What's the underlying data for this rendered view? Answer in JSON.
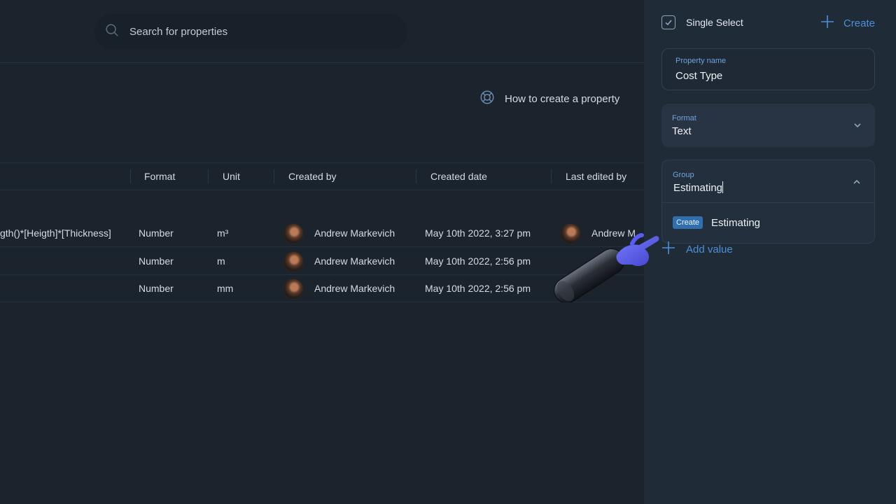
{
  "search": {
    "placeholder": "Search for properties"
  },
  "help": {
    "label": "How to create a property"
  },
  "table": {
    "columns": [
      "Format",
      "Unit",
      "Created by",
      "Created date",
      "Last edited by"
    ],
    "rows": [
      {
        "formula": "gth()*[Heigth]*[Thickness]",
        "format": "Number",
        "unit": "m³",
        "created_by": "Andrew Markevich",
        "created_date": "May 10th 2022, 3:27 pm",
        "last_edited_by": "Andrew M"
      },
      {
        "formula": "",
        "format": "Number",
        "unit": "m",
        "created_by": "Andrew Markevich",
        "created_date": "May 10th 2022, 2:56 pm",
        "last_edited_by": ""
      },
      {
        "formula": "",
        "format": "Number",
        "unit": "mm",
        "created_by": "Andrew Markevich",
        "created_date": "May 10th 2022, 2:56 pm",
        "last_edited_by": ""
      }
    ]
  },
  "panel": {
    "type_label": "Single Select",
    "create_label": "Create",
    "property_name": {
      "label": "Property name",
      "value": "Cost Type"
    },
    "format": {
      "label": "Format",
      "value": "Text"
    },
    "group": {
      "label": "Group",
      "value": "Estimating",
      "option_badge": "Create",
      "option_label": "Estimating"
    },
    "add_value_label": "Add value"
  },
  "colors": {
    "accent": "#4f8ed9",
    "badge": "#2f6fae",
    "background": "#1b232d",
    "panel": "#202b38"
  }
}
